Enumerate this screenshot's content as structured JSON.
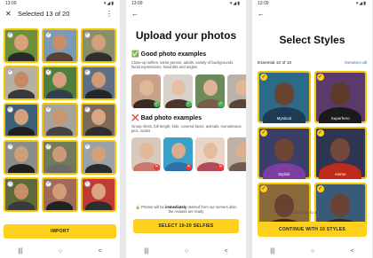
{
  "screen1": {
    "status_time": "13:09",
    "status_icons": "▾◢▮",
    "title": "Selected 13 of 20",
    "import_label": "IMPORT",
    "tiles": [
      {
        "bg": "#6b8f3a",
        "skin": "#d9a27a",
        "body": "#2a2a2a",
        "check": "✓"
      },
      {
        "bg": "#7a9ab8",
        "skin": "#c98e68",
        "body": "#5a4032",
        "check": "✓"
      },
      {
        "bg": "#8a8f6b",
        "skin": "#d1a07c",
        "body": "#30302e",
        "check": "✓"
      },
      {
        "bg": "#b7b0a0",
        "skin": "#c48a66",
        "body": "#3a3a3a",
        "check": "✓"
      },
      {
        "bg": "#4f7f3e",
        "skin": "#d6a080",
        "body": "#333f4f",
        "check": "✓"
      },
      {
        "bg": "#5d6f86",
        "skin": "#cf9b75",
        "body": "#262626",
        "check": "✓"
      },
      {
        "bg": "#3e5f7a",
        "skin": "#d4a07a",
        "body": "#1f1f1f",
        "check": "✓"
      },
      {
        "bg": "#a8a39a",
        "skin": "#c99673",
        "body": "#444444",
        "check": "✓"
      },
      {
        "bg": "#7b6a58",
        "skin": "#d8a684",
        "body": "#2e2e2e",
        "check": "✓"
      },
      {
        "bg": "#8c8c88",
        "skin": "#caa07c",
        "body": "#1e1e1e",
        "check": "○"
      },
      {
        "bg": "#6f7b5a",
        "skin": "#cc9a78",
        "body": "#6a6a6a",
        "check": "✓"
      },
      {
        "bg": "#9aa2a8",
        "skin": "#d0a07a",
        "body": "#2b2b2b",
        "check": "○"
      },
      {
        "bg": "#5e6a3c",
        "skin": "#c59068",
        "body": "#3a3a3a",
        "check": "○"
      },
      {
        "bg": "#a06a5a",
        "skin": "#d29c78",
        "body": "#222222",
        "check": "✓"
      },
      {
        "bg": "#c03a36",
        "skin": "#d9a47e",
        "body": "#2e2e2e",
        "check": "○"
      }
    ],
    "nav": [
      "|||",
      "○",
      "<"
    ]
  },
  "screen2": {
    "status_time": "13:09",
    "status_icons": "▾◢▮",
    "back_icon": "←",
    "heading": "Upload your photos",
    "good_title": "✅ Good photo examples",
    "good_desc": "Close-up selfies, same person, adults, variety of backgrounds, facial expressions, head tilts and angles",
    "good_photos": [
      {
        "bg": "#c6a28c",
        "skin": "#e2b798",
        "body": "#3a2a24"
      },
      {
        "bg": "#d9d2cc",
        "skin": "#e6bfa3",
        "body": "#4b362c"
      },
      {
        "bg": "#6f8a5a",
        "skin": "#dfb496",
        "body": "#7a5d48"
      },
      {
        "bg": "#b8b2a8",
        "skin": "#e0b697",
        "body": "#5a4438"
      }
    ],
    "bad_title": "❌ Bad photo examples",
    "bad_desc": "Group shots, full-length, kids, covered faces, animals, monotonous pics, nudes",
    "bad_photos": [
      {
        "bg": "#d8c9bd",
        "skin": "#e3b99a",
        "body": "#c97a6a"
      },
      {
        "bg": "#3aa0c8",
        "skin": "#d9ad8e",
        "body": "#2e6fa8"
      },
      {
        "bg": "#e8d5c8",
        "skin": "#e4bc9e",
        "body": "#b24a5a"
      },
      {
        "bg": "#bfb1a6",
        "skin": "#dcae90",
        "body": "#6e5a50"
      }
    ],
    "note_prefix": "🔒 Photos will be ",
    "note_bold": "immediately",
    "note_suffix": " deleted from our servers after the Avatars are ready",
    "cta_label": "SELECT 10-20 SELFIES",
    "nav": [
      "|||",
      "○",
      "<"
    ]
  },
  "screen3": {
    "status_time": "13:09",
    "status_icons": "▾◢▮",
    "back_icon": "←",
    "heading": "Select Styles",
    "essential_label": "Essential 10 of 10",
    "deselect_label": "Deselect all",
    "styles": [
      {
        "name": "Mystical",
        "bg": "#2c6a8a",
        "skin": "#6a4230",
        "body": "#1d3b52"
      },
      {
        "name": "Superhero",
        "bg": "#5a3a6a",
        "skin": "#5e3a2a",
        "body": "#1a1a1a"
      },
      {
        "name": "Stylish",
        "bg": "#3a3f6a",
        "skin": "#6e4432",
        "body": "#7a3fa0"
      },
      {
        "name": "Anime",
        "bg": "#2d3552",
        "skin": "#72483a",
        "body": "#c02a1a"
      },
      {
        "name": "",
        "bg": "#8a6a3a",
        "skin": "#6a4030",
        "body": "#3a2a1a"
      },
      {
        "name": "",
        "bg": "#3a5a7a",
        "skin": "#6a4232",
        "body": "#2a2a2a"
      }
    ],
    "hint": "You can select up to 10 styles at a time",
    "cta_label": "CONTINUE WITH 10 STYLES",
    "check_glyph": "✓",
    "nav": [
      "|||",
      "○",
      "<"
    ]
  }
}
